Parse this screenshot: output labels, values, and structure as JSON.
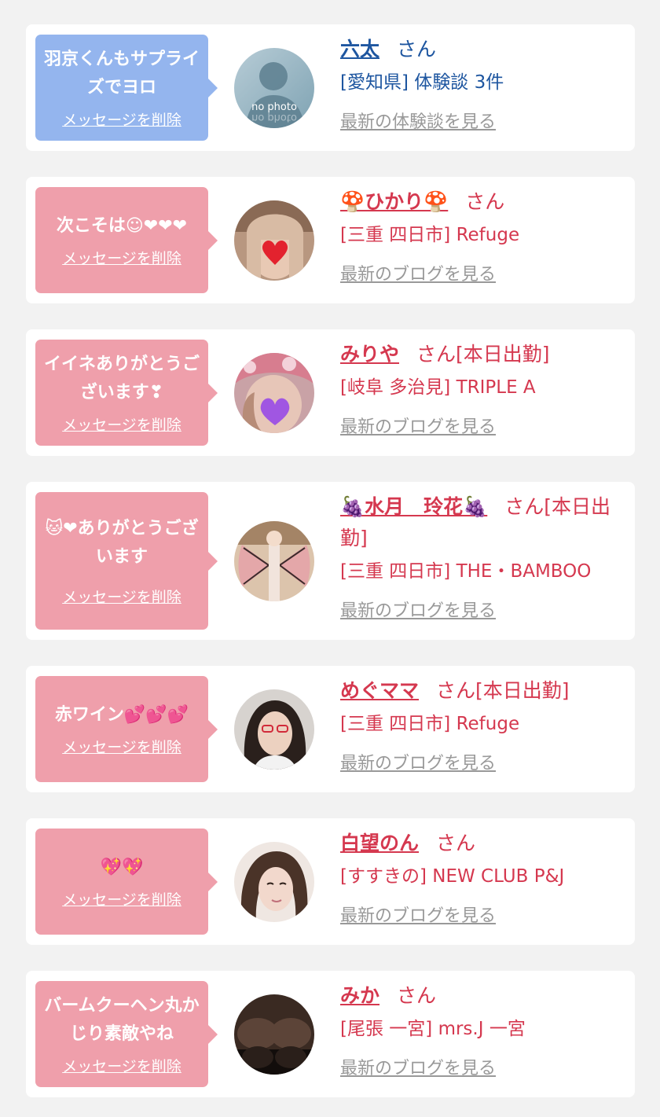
{
  "items": [
    {
      "message": "羽京くんもサプライズでヨロ",
      "delete_label": "メッセージを削除",
      "name": "六太",
      "suffix": "さん",
      "shop": "[愛知県] 体験談 3件",
      "link": "最新の体験談を見る",
      "avatar_label": "no photo",
      "theme": "blue"
    },
    {
      "message": "次こそは☺❤❤❤",
      "delete_label": "メッセージを削除",
      "name": "🍄ひかり🍄",
      "suffix": "さん",
      "shop": "[三重 四日市] Refuge",
      "link": "最新のブログを見る",
      "theme": "pink"
    },
    {
      "message": "イイネありがとうございます❣",
      "delete_label": "メッセージを削除",
      "name": "みりや",
      "suffix": "さん[本日出勤]",
      "shop": "[岐阜 多治見] TRIPLE A",
      "link": "最新のブログを見る",
      "theme": "pink"
    },
    {
      "message": "🐱❤ありがとうございます",
      "delete_label": "メッセージを削除",
      "name": "🍇水月　玲花🍇",
      "suffix": "さん[本日出勤]",
      "shop": "[三重 四日市] THE・BAMBOO",
      "link": "最新のブログを見る",
      "theme": "pink"
    },
    {
      "message": "赤ワイン💕💕💕",
      "delete_label": "メッセージを削除",
      "name": "めぐママ",
      "suffix": "さん[本日出勤]",
      "shop": "[三重 四日市] Refuge",
      "link": "最新のブログを見る",
      "theme": "pink"
    },
    {
      "message": "💖💖",
      "delete_label": "メッセージを削除",
      "name": "白望のん",
      "suffix": "さん",
      "shop": "[すすきの] NEW CLUB P&J",
      "link": "最新のブログを見る",
      "theme": "pink"
    },
    {
      "message": "バームクーヘン丸かじり素敵やね",
      "delete_label": "メッセージを削除",
      "name": "みか",
      "suffix": "さん",
      "shop": "[尾張 一宮] mrs.J 一宮",
      "link": "最新のブログを見る",
      "theme": "pink"
    }
  ],
  "colors": {
    "page_bg": "#f2f2f2",
    "card_bg": "#ffffff",
    "bubble_blue": "#94b5ee",
    "bubble_pink": "#ef9fab",
    "text_blue": "#1e56a0",
    "text_red": "#d5384f",
    "link_gray": "#999999"
  }
}
